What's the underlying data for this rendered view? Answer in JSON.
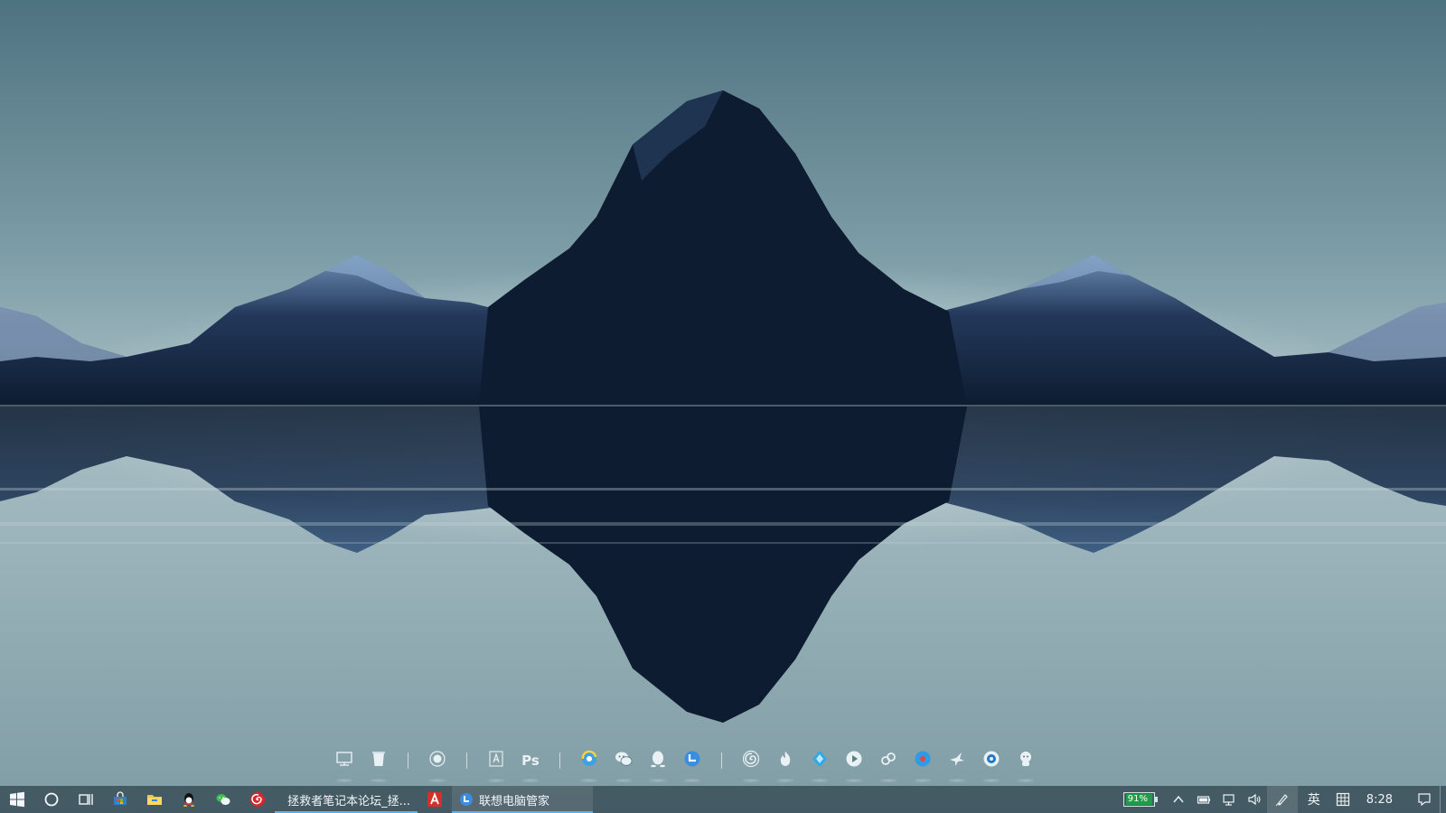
{
  "dock": {
    "items": [
      {
        "name": "this-pc-icon"
      },
      {
        "name": "recycle-bin-icon"
      },
      {
        "sep": true
      },
      {
        "name": "record-icon"
      },
      {
        "sep": true
      },
      {
        "name": "font-app-icon"
      },
      {
        "name": "photoshop-icon",
        "label": "Ps"
      },
      {
        "sep": true
      },
      {
        "name": "browser-icon"
      },
      {
        "name": "wechat-icon"
      },
      {
        "name": "qq-icon"
      },
      {
        "name": "lenovo-manager-icon"
      },
      {
        "sep": true
      },
      {
        "name": "netease-music-icon"
      },
      {
        "name": "fire-icon"
      },
      {
        "name": "diamond-icon"
      },
      {
        "name": "video-player-icon"
      },
      {
        "name": "link-icon"
      },
      {
        "name": "music-player-icon"
      },
      {
        "name": "bird-icon"
      },
      {
        "name": "camera-icon"
      },
      {
        "name": "mascot-icon"
      }
    ]
  },
  "taskbar": {
    "pinned": [
      {
        "name": "start-icon"
      },
      {
        "name": "search-circle-icon"
      },
      {
        "name": "task-view-icon"
      },
      {
        "name": "store-icon"
      },
      {
        "name": "file-explorer-icon"
      },
      {
        "name": "qq-taskbar-icon"
      },
      {
        "name": "wechat-taskbar-icon"
      },
      {
        "name": "netease-taskbar-icon"
      }
    ],
    "windows": [
      {
        "label": "拯救者笔记本论坛_拯...",
        "icon": "browser-window-icon",
        "active": false
      },
      {
        "label": "联想电脑管家",
        "icon": "lenovo-window-icon",
        "active": true
      }
    ],
    "acrobat_icon": "acrobat-icon"
  },
  "tray": {
    "battery_percent": "91%",
    "battery_level": 0.91,
    "ime_mode": "英",
    "clock": "8:28"
  },
  "colors": {
    "mountain": "#0d1c30",
    "mountain_light": "#3f5f86",
    "taskbar_bg": "#344a54",
    "accent": "#5fb0e8",
    "battery_green": "#1f9d48"
  }
}
